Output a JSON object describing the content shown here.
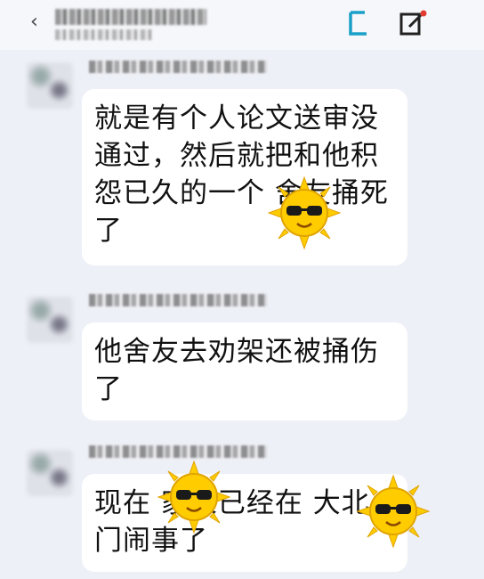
{
  "header": {
    "back_icon": "chevron-left-icon",
    "title": "",
    "subtitle": "",
    "actions": [
      {
        "icon": "sidebar-icon"
      },
      {
        "icon": "edit-icon"
      }
    ]
  },
  "messages": [
    {
      "text": "就是有个人论文送审没通过，然后就把和他积怨已久的一个  舍友捅死了"
    },
    {
      "text": "他舍友去劝架还被捅伤了"
    },
    {
      "text": "现在  家长已经在  大北门闹事了"
    }
  ],
  "colors": {
    "background": "#eef0f7",
    "bubble": "#ffffff",
    "accent": "#1aa0c8",
    "sticker": "#ffcc00"
  }
}
